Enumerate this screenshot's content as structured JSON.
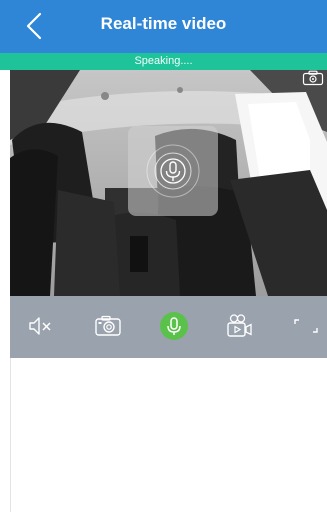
{
  "header": {
    "title": "Real-time video",
    "back_icon": "chevron-left-icon"
  },
  "status": {
    "text": "Speaking...."
  },
  "video": {
    "snapshot_overlay_icon": "camera-switch-icon",
    "mic_overlay_icon": "microphone-pulse-icon"
  },
  "toolbar": {
    "items": [
      {
        "icon": "mute-icon"
      },
      {
        "icon": "camera-icon"
      },
      {
        "icon": "microphone-icon",
        "active": true
      },
      {
        "icon": "video-record-icon"
      },
      {
        "icon": "fullscreen-icon"
      }
    ]
  },
  "colors": {
    "header_bg": "#2f86d6",
    "status_bg": "#1fc39a",
    "toolbar_bg": "#9aa2ad",
    "mic_active": "#5ac24a"
  }
}
